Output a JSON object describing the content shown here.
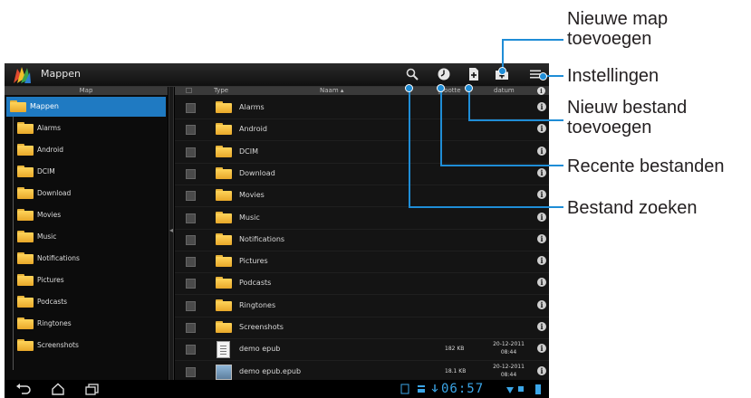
{
  "app": {
    "title": "Mappen"
  },
  "left_pane": {
    "header": "Map",
    "root": "Mappen",
    "items": [
      "Alarms",
      "Android",
      "DCIM",
      "Download",
      "Movies",
      "Music",
      "Notifications",
      "Pictures",
      "Podcasts",
      "Ringtones",
      "Screenshots"
    ]
  },
  "columns": {
    "type": "Type",
    "name": "Naam",
    "size": "grootte",
    "date": "datum"
  },
  "files": [
    {
      "name": "Alarms",
      "kind": "folder",
      "size": "",
      "date": "",
      "time": ""
    },
    {
      "name": "Android",
      "kind": "folder",
      "size": "",
      "date": "",
      "time": ""
    },
    {
      "name": "DCIM",
      "kind": "folder",
      "size": "",
      "date": "",
      "time": ""
    },
    {
      "name": "Download",
      "kind": "folder",
      "size": "",
      "date": "",
      "time": ""
    },
    {
      "name": "Movies",
      "kind": "folder",
      "size": "",
      "date": "",
      "time": ""
    },
    {
      "name": "Music",
      "kind": "folder",
      "size": "",
      "date": "",
      "time": ""
    },
    {
      "name": "Notifications",
      "kind": "folder",
      "size": "",
      "date": "",
      "time": ""
    },
    {
      "name": "Pictures",
      "kind": "folder",
      "size": "",
      "date": "",
      "time": ""
    },
    {
      "name": "Podcasts",
      "kind": "folder",
      "size": "",
      "date": "",
      "time": ""
    },
    {
      "name": "Ringtones",
      "kind": "folder",
      "size": "",
      "date": "",
      "time": ""
    },
    {
      "name": "Screenshots",
      "kind": "folder",
      "size": "",
      "date": "",
      "time": ""
    },
    {
      "name": "demo epub",
      "kind": "document",
      "size": "182 KB",
      "date": "20-12-2011",
      "time": "08:44"
    },
    {
      "name": "demo epub.epub",
      "kind": "image",
      "size": "18.1 KB",
      "date": "20-12-2011",
      "time": "08:44"
    }
  ],
  "status": {
    "clock": "06:57"
  },
  "callouts": {
    "new_folder": [
      "Nieuwe map",
      "toevoegen"
    ],
    "settings": "Instellingen",
    "new_file": [
      "Nieuw bestand",
      "toevoegen"
    ],
    "recent": "Recente bestanden",
    "search": "Bestand zoeken"
  },
  "icons": [
    "search-icon",
    "clock-icon",
    "new-file-icon",
    "new-folder-icon",
    "menu-icon",
    "back-icon",
    "home-icon",
    "recent-apps-icon"
  ],
  "colors": {
    "accent": "#1f8dd6",
    "selection": "#1f7ac2",
    "clock": "#3ba6e8"
  }
}
